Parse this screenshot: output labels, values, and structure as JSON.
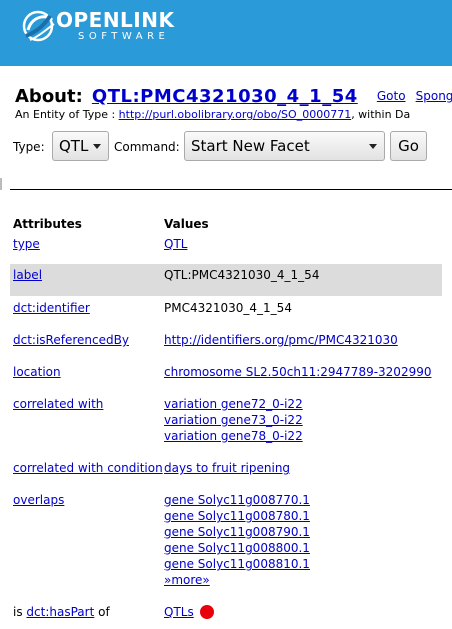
{
  "header": {
    "logo_main": "OPENLINK",
    "logo_sub": "SOFTWARE",
    "colors": {
      "banner": "#2a9ad8",
      "link": "#0000cc",
      "highlight_row": "#dcdcdc",
      "dot": "#e8000a"
    }
  },
  "title": {
    "about_label": "About:",
    "entity_name": "QTL:PMC4321030_4_1_54",
    "goto": "Goto",
    "sponge": "Sponge"
  },
  "entity": {
    "prefix": "An Entity of Type :",
    "type_uri": "http://purl.obolibrary.org/obo/SO_0000771",
    "suffix": ", within Da"
  },
  "controls": {
    "type_label": "Type:",
    "type_value": "QTL",
    "command_label": "Command:",
    "command_value": "Start New Facet",
    "go_label": "Go"
  },
  "table": {
    "attributes_header": "Attributes",
    "values_header": "Values",
    "rows": [
      {
        "attr": "type",
        "values": [
          "QTL"
        ]
      },
      {
        "attr": "label",
        "values": [
          "QTL:PMC4321030_4_1_54"
        ]
      },
      {
        "attr": "dct:identifier",
        "values": [
          "PMC4321030_4_1_54"
        ]
      },
      {
        "attr": "dct:isReferencedBy",
        "values": [
          "http://identifiers.org/pmc/PMC4321030"
        ]
      },
      {
        "attr": "location",
        "values": [
          "chromosome SL2.50ch11:2947789-3202990"
        ]
      },
      {
        "attr": "correlated with",
        "values": [
          "variation gene72_0-i22",
          "variation gene73_0-i22",
          "variation gene78_0-i22"
        ]
      },
      {
        "attr": "correlated with condition",
        "values": [
          "days to fruit ripening"
        ]
      },
      {
        "attr": "overlaps",
        "values": [
          "gene Solyc11g008770.1",
          "gene Solyc11g008780.1",
          "gene Solyc11g008790.1",
          "gene Solyc11g008800.1",
          "gene Solyc11g008810.1",
          "»more»"
        ]
      },
      {
        "attr_prefix": "is",
        "attr": "dct:hasPart",
        "attr_suffix": "of",
        "values": [
          "QTLs"
        ]
      }
    ]
  }
}
